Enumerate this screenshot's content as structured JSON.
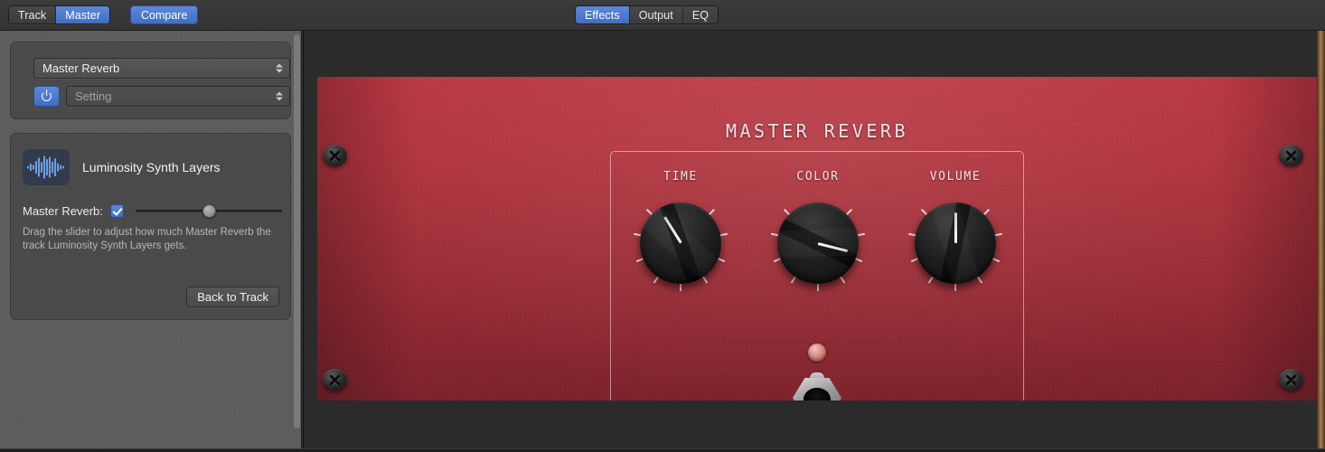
{
  "toolbar": {
    "left_segments": [
      {
        "label": "Track",
        "active": false
      },
      {
        "label": "Master",
        "active": true
      }
    ],
    "compare_label": "Compare",
    "center_segments": [
      {
        "label": "Effects",
        "active": true
      },
      {
        "label": "Output",
        "active": false
      },
      {
        "label": "EQ",
        "active": false
      }
    ]
  },
  "sidebar": {
    "plugin_select": {
      "value": "Master Reverb",
      "icon": "chevron-updown-icon"
    },
    "power_button": {
      "icon": "power-icon",
      "state": "on"
    },
    "setting_select": {
      "placeholder": "Setting",
      "value": "Setting",
      "icon": "chevron-updown-icon"
    },
    "track": {
      "icon": "audio-waveform-icon",
      "name": "Luminosity Synth Layers"
    },
    "send": {
      "label": "Master Reverb:",
      "checkbox_checked": true,
      "slider_value_percent": 50
    },
    "hint_text": "Drag the slider to adjust how much Master Reverb the track Luminosity Synth Layers gets.",
    "back_button_label": "Back to Track"
  },
  "plugin": {
    "title": "MASTER REVERB",
    "knobs": [
      {
        "label": "TIME",
        "angle_deg": -32,
        "tick_count": 9
      },
      {
        "label": "COLOR",
        "angle_deg": 104,
        "tick_count": 9
      },
      {
        "label": "VOLUME",
        "angle_deg": 0,
        "tick_count": 9
      }
    ],
    "led": {
      "name": "status-led",
      "state": "off"
    },
    "footswitch": {
      "name": "footswitch",
      "state": "up"
    },
    "screws": 4
  },
  "colors": {
    "accent_blue": "#4d7bd0",
    "chassis_red": "#a82f3a",
    "panel_gray": "#5c5c5c",
    "toolbar_gray": "#3b3b3b",
    "wood_edge": "#a67a4e"
  }
}
